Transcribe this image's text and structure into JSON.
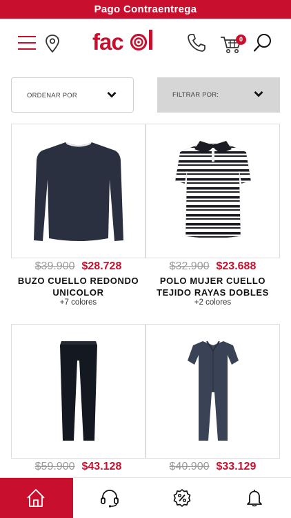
{
  "promo": {
    "text": "Pago Contraentrega"
  },
  "header": {
    "logo_text": "facol",
    "cart_count": "0",
    "icons": [
      "menu-icon",
      "location-pin-icon",
      "phone-icon",
      "cart-icon",
      "search-icon"
    ]
  },
  "filters": {
    "sort_label": "ORDENAR POR",
    "filter_label": "FILTRAR POR:"
  },
  "products": [
    {
      "old_price": "$39.900",
      "new_price": "$28.728",
      "name_line1": "BUZO CUELLO REDONDO",
      "name_line2": "UNICOLOR",
      "colors": "+7 colores"
    },
    {
      "old_price": "$32.900",
      "new_price": "$23.688",
      "name_line1": "POLO MUJER CUELLO",
      "name_line2": "TEJIDO RAYAS DOBLES",
      "colors": "+2 colores"
    },
    {
      "old_price": "$59.900",
      "new_price": "$43.128",
      "name_line1": "",
      "name_line2": "",
      "colors": ""
    },
    {
      "old_price": "$40.900",
      "new_price": "$33.129",
      "name_line1": "",
      "name_line2": "",
      "colors": ""
    }
  ],
  "bottom_nav": [
    {
      "icon": "home-icon",
      "active": true
    },
    {
      "icon": "headset-icon",
      "active": false
    },
    {
      "icon": "discount-icon",
      "active": false
    },
    {
      "icon": "bell-icon",
      "active": false
    }
  ],
  "colors": {
    "brand": "#c8102e",
    "filter_bg": "#d6d6d6",
    "old_price": "#9a9a9a"
  }
}
